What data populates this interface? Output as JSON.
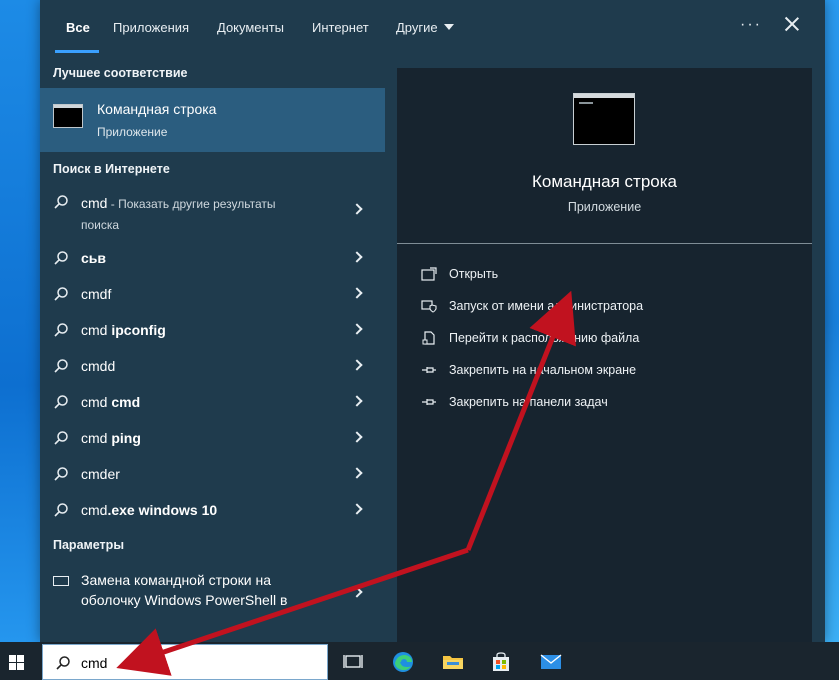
{
  "tabs": [
    {
      "label": "Все",
      "active": true
    },
    {
      "label": "Приложения"
    },
    {
      "label": "Документы"
    },
    {
      "label": "Интернет"
    },
    {
      "label": "Другие"
    }
  ],
  "icons": {
    "more": "more-options-icon",
    "close": "close-icon"
  },
  "best_match": {
    "section_title": "Лучшее соответствие",
    "title": "Командная строка",
    "subtitle": "Приложение"
  },
  "web_search": {
    "section_title": "Поиск в Интернете",
    "first": {
      "query": "cmd",
      "suffix_line1": " - Показать другие результаты",
      "suffix_line2": "поиска"
    },
    "items": [
      {
        "base": "",
        "bold": "сьв"
      },
      {
        "base": "cmdf",
        "bold": ""
      },
      {
        "base": "cmd ",
        "bold": "ipconfig"
      },
      {
        "base": "cmdd",
        "bold": ""
      },
      {
        "base": "cmd ",
        "bold": "cmd"
      },
      {
        "base": "cmd ",
        "bold": "ping"
      },
      {
        "base": "cmder",
        "bold": ""
      },
      {
        "base": "cmd",
        "bold": ".exe windows 10"
      }
    ]
  },
  "settings": {
    "section_title": "Параметры",
    "line1": "Замена командной строки на",
    "line2": "оболочку Windows PowerShell в"
  },
  "preview": {
    "title": "Командная строка",
    "subtitle": "Приложение",
    "actions": [
      {
        "label": "Открыть",
        "icon": "open-icon"
      },
      {
        "label": "Запуск от имени администратора",
        "icon": "shield-icon"
      },
      {
        "label": "Перейти к расположению файла",
        "icon": "file-location-icon"
      },
      {
        "label": "Закрепить на начальном экране",
        "icon": "pin-icon"
      },
      {
        "label": "Закрепить на панели задач",
        "icon": "pin-icon"
      }
    ]
  },
  "taskbar": {
    "search_value": "cmd",
    "icons": [
      "windows-logo-icon",
      "task-view-icon",
      "edge-icon",
      "file-explorer-icon",
      "store-icon",
      "mail-icon"
    ]
  },
  "colors": {
    "panel": "#1f3b4d",
    "selected": "#2b5d7f",
    "preview": "#17242f",
    "accent": "#3aa0ff",
    "annotation": "#c1121f"
  }
}
